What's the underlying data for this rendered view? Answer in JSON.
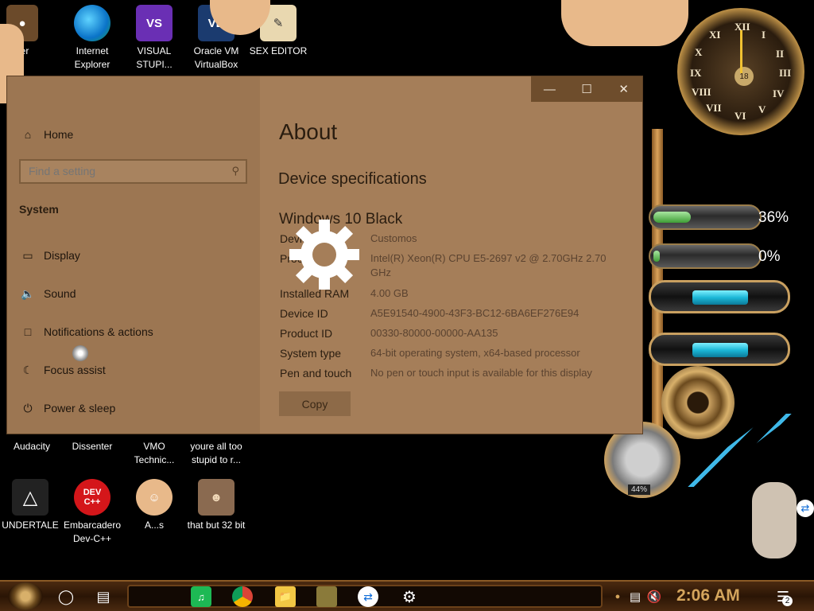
{
  "desktop": {
    "icons_top": [
      {
        "label": "ser",
        "icon": "browser-icon"
      },
      {
        "label": "Internet Explorer",
        "icon": "edge-icon"
      },
      {
        "label": "VISUAL STUPI...",
        "icon": "visual-studio-icon"
      },
      {
        "label": "Oracle VM VirtualBox",
        "icon": "virtualbox-icon"
      },
      {
        "label": "SEX EDITOR",
        "icon": "editor-icon"
      }
    ],
    "icons_row2": [
      {
        "label": "Audacity"
      },
      {
        "label": "Dissenter"
      },
      {
        "label": "VMO Technic..."
      },
      {
        "label": "youre all too stupid to r..."
      }
    ],
    "icons_row3": [
      {
        "label": "UNDERTALE",
        "icon": "unity-icon"
      },
      {
        "label": "Embarcadero Dev-C++",
        "icon": "devcpp-icon",
        "badge": "DEV C++"
      },
      {
        "label": "A...s",
        "icon": "character-icon"
      },
      {
        "label": "that but 32 bit",
        "icon": "portrait-icon"
      }
    ],
    "gauges": {
      "cpu_percent": "36%",
      "cpu_fill": 0.36,
      "mem_percent": "0%",
      "mem_fill": 0.02
    },
    "clock_numerals": [
      "XII",
      "I",
      "II",
      "III",
      "IV",
      "V",
      "VI",
      "VII",
      "VIII",
      "IX",
      "X",
      "XI"
    ],
    "clock_center": "18",
    "gauge_dial": "44%"
  },
  "window": {
    "controls": {
      "minimize": "—",
      "maximize": "☐",
      "close": "✕"
    },
    "nav": {
      "home": "Home",
      "search_placeholder": "Find a setting",
      "section": "System",
      "items": [
        {
          "label": "Display",
          "icon": "display-icon"
        },
        {
          "label": "Sound",
          "icon": "sound-icon"
        },
        {
          "label": "Notifications & actions",
          "icon": "notifications-icon"
        },
        {
          "label": "Focus assist",
          "icon": "focus-assist-icon"
        },
        {
          "label": "Power & sleep",
          "icon": "power-icon"
        }
      ]
    },
    "about": {
      "title": "About",
      "heading": "Device specifications",
      "windows_name": "Windows 10 Black",
      "specs": [
        {
          "label": "Device name",
          "value": "Customos"
        },
        {
          "label": "Processor",
          "value": "Intel(R) Xeon(R) CPU E5-2697 v2 @ 2.70GHz 2.70 GHz"
        },
        {
          "label": "Installed RAM",
          "value": "4.00 GB"
        },
        {
          "label": "Device ID",
          "value": "A5E91540-4900-43F3-BC12-6BA6EF276E94"
        },
        {
          "label": "Product ID",
          "value": "00330-80000-00000-AA135"
        },
        {
          "label": "System type",
          "value": "64-bit operating system, x64-based processor"
        },
        {
          "label": "Pen and touch",
          "value": "No pen or touch input is available for this display"
        }
      ],
      "copy_button": "Copy"
    }
  },
  "taskbar": {
    "clock": "2:06 AM",
    "notification_count": "2",
    "pinned": [
      "spotify-icon",
      "chrome-icon",
      "file-explorer-icon",
      "game-icon",
      "teamviewer-icon",
      "settings-icon"
    ]
  }
}
